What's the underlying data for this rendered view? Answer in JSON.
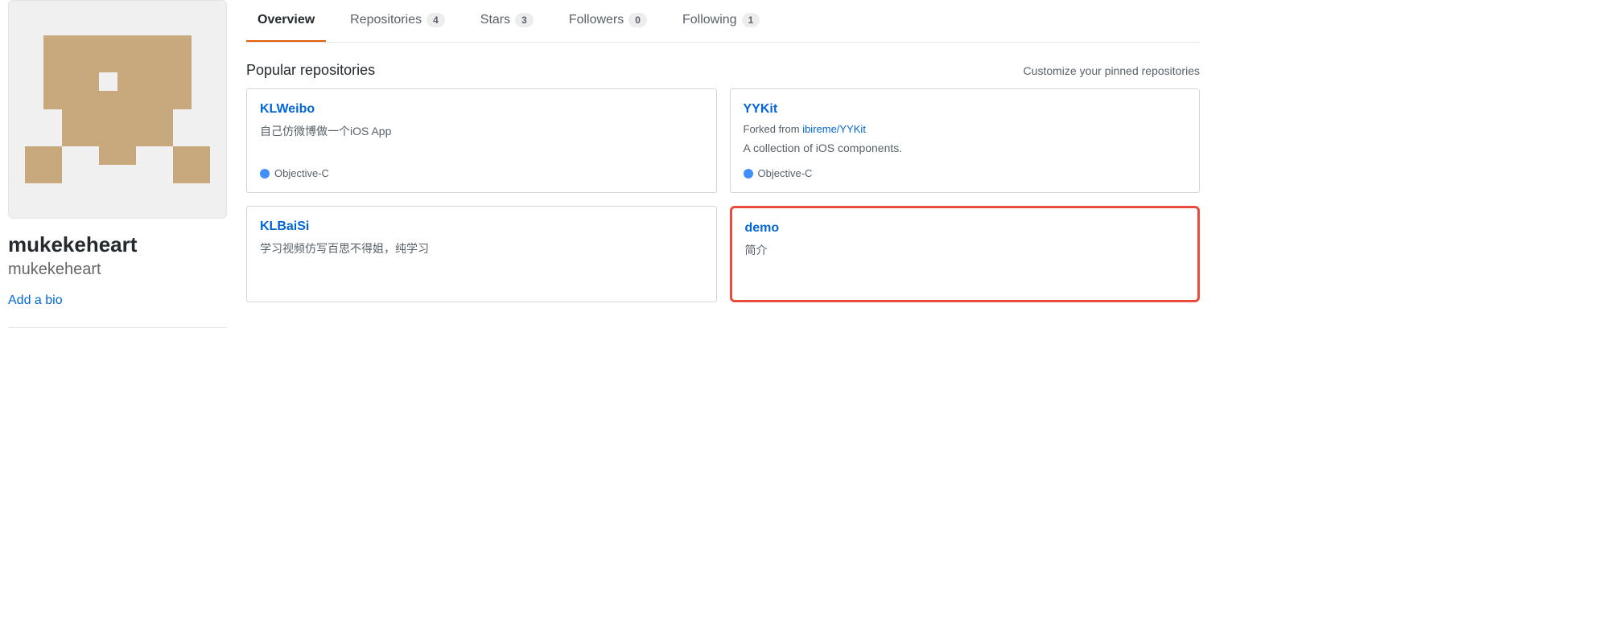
{
  "profile": {
    "display_name": "mukekeheart",
    "username": "mukekeheart",
    "add_bio": "Add a bio"
  },
  "tabs": [
    {
      "label": "Overview",
      "count": null,
      "active": true
    },
    {
      "label": "Repositories",
      "count": "4",
      "active": false
    },
    {
      "label": "Stars",
      "count": "3",
      "active": false
    },
    {
      "label": "Followers",
      "count": "0",
      "active": false
    },
    {
      "label": "Following",
      "count": "1",
      "active": false
    }
  ],
  "section": {
    "title": "Popular repositories",
    "customize": "Customize your pinned repositories"
  },
  "repos": [
    {
      "name": "KLWeibo",
      "forked_prefix": "",
      "forked_link": "",
      "desc": "自己仿微博做一个iOS App",
      "lang": "Objective-C",
      "lang_color": "#438eff",
      "highlighted": false
    },
    {
      "name": "YYKit",
      "forked_prefix": "Forked from ",
      "forked_link": "ibireme/YYKit",
      "desc": "A collection of iOS components.",
      "lang": "Objective-C",
      "lang_color": "#438eff",
      "highlighted": false
    },
    {
      "name": "KLBaiSi",
      "forked_prefix": "",
      "forked_link": "",
      "desc": "学习视频仿写百思不得姐，纯学习",
      "lang": "",
      "lang_color": "",
      "highlighted": false
    },
    {
      "name": "demo",
      "forked_prefix": "",
      "forked_link": "",
      "desc": "简介",
      "lang": "",
      "lang_color": "",
      "highlighted": true
    }
  ]
}
